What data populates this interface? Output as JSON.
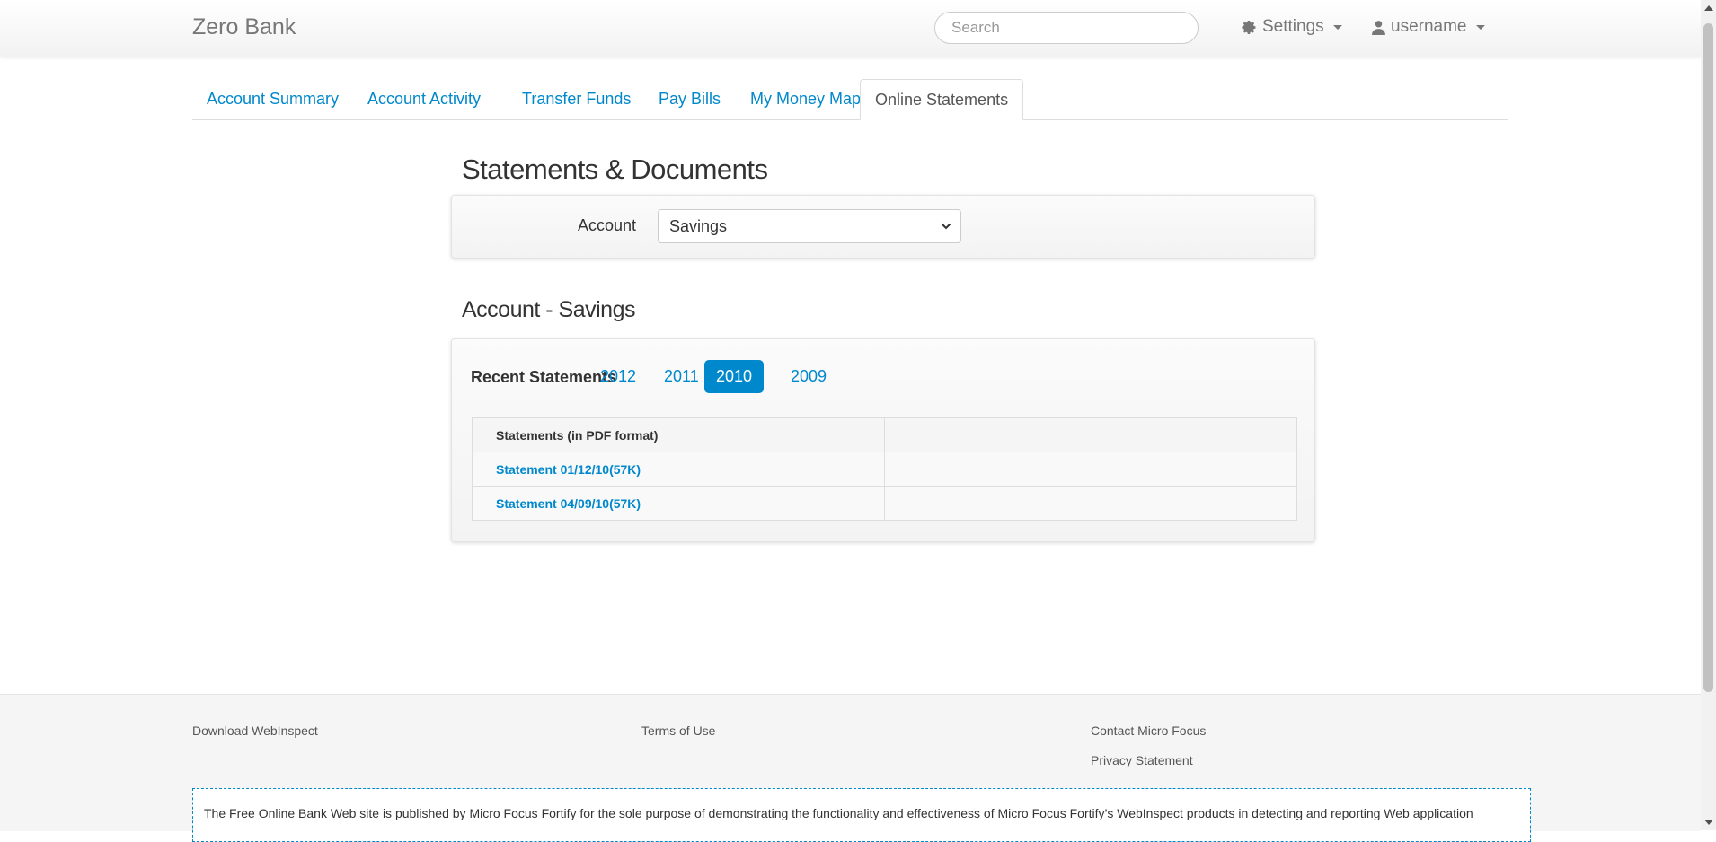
{
  "navbar": {
    "brand": "Zero Bank",
    "search_placeholder": "Search",
    "settings_label": "Settings",
    "user_label": "username"
  },
  "tabs": [
    {
      "label": "Account Summary"
    },
    {
      "label": "Account Activity"
    },
    {
      "label": "Transfer Funds"
    },
    {
      "label": "Pay Bills"
    },
    {
      "label": "My Money Map"
    },
    {
      "label": "Online Statements",
      "active": true
    }
  ],
  "main": {
    "title": "Statements & Documents",
    "account_label": "Account",
    "account_selected": "Savings",
    "account_heading": "Account - Savings"
  },
  "statements": {
    "recent_label": "Recent Statements",
    "years": [
      {
        "label": "2012"
      },
      {
        "label": "2011"
      },
      {
        "label": "2010",
        "active": true
      },
      {
        "label": "2009"
      }
    ],
    "table_header": "Statements (in PDF format)",
    "rows": [
      {
        "label": "Statement 01/12/10(57K)"
      },
      {
        "label": "Statement 04/09/10(57K)"
      }
    ]
  },
  "footer": {
    "download": "Download WebInspect",
    "terms": "Terms of Use",
    "contact": "Contact Micro Focus",
    "privacy": "Privacy Statement",
    "disclaimer": "The Free Online Bank Web site is published by Micro Focus Fortify for the sole purpose of demonstrating the functionality and effectiveness of Micro Focus Fortify’s WebInspect products in detecting and reporting Web application"
  },
  "colors": {
    "link": "#0088cc",
    "active_pill": "#0088cc"
  }
}
